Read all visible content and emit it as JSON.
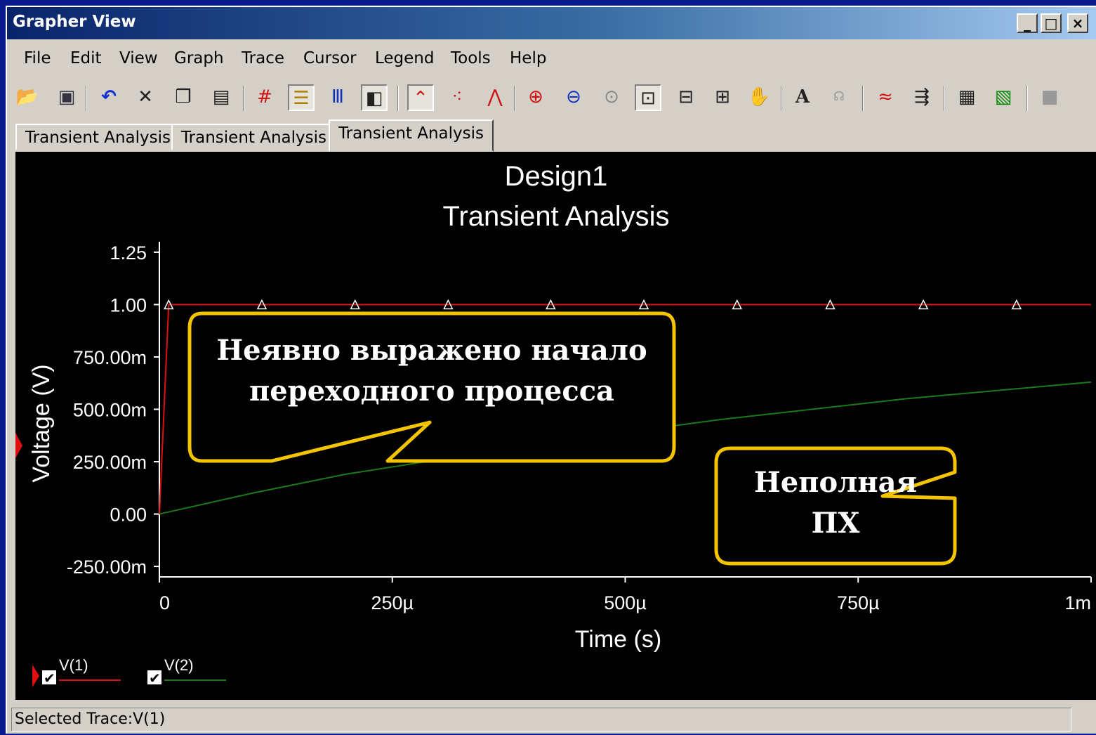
{
  "window": {
    "title": "Grapher View",
    "controls": [
      "_",
      "□",
      "×"
    ]
  },
  "menu": [
    "File",
    "Edit",
    "View",
    "Graph",
    "Trace",
    "Cursor",
    "Legend",
    "Tools",
    "Help"
  ],
  "toolbar": {
    "icons": [
      "open-icon",
      "save-icon",
      "undo-icon",
      "delete-icon",
      "copy-icon",
      "paste-icon",
      "grid-icon",
      "legend-icon",
      "dual-axis-icon",
      "overlay-icon",
      "lines-icon",
      "points-icon",
      "lines-points-icon",
      "zoom-in-icon",
      "zoom-out-icon",
      "zoom-full-icon",
      "zoom-window-icon",
      "zoom-x-icon",
      "zoom-y-icon",
      "pan-icon",
      "text-icon",
      "label-icon",
      "cursor-icon",
      "export-icon",
      "properties-icon",
      "excel-icon",
      "stop-icon"
    ]
  },
  "tabs": [
    "Transient Analysis",
    "Transient Analysis",
    "Transient Analysis"
  ],
  "active_tab": 2,
  "chart_data": {
    "type": "line",
    "title": "Design1",
    "subtitle": "Transient Analysis",
    "xlabel": "Time (s)",
    "ylabel": "Voltage (V)",
    "xlim": [
      0,
      0.001
    ],
    "ylim": [
      -0.3,
      1.3
    ],
    "x_ticks": [
      {
        "v": 0,
        "label": "0"
      },
      {
        "v": 0.00025,
        "label": "250µ"
      },
      {
        "v": 0.0005,
        "label": "500µ"
      },
      {
        "v": 0.00075,
        "label": "750µ"
      },
      {
        "v": 0.001,
        "label": "1m"
      }
    ],
    "y_ticks": [
      {
        "v": 1.25,
        "label": "1.25"
      },
      {
        "v": 1.0,
        "label": "1.00"
      },
      {
        "v": 0.75,
        "label": "750.00m"
      },
      {
        "v": 0.5,
        "label": "500.00m"
      },
      {
        "v": 0.25,
        "label": "250.00m"
      },
      {
        "v": 0.0,
        "label": "0.00"
      },
      {
        "v": -0.25,
        "label": "-250.00m"
      }
    ],
    "series": [
      {
        "name": "V(1)",
        "color": "#e01010",
        "markers": "triangle",
        "x": [
          0,
          1e-05,
          0.00011,
          0.00021,
          0.00031,
          0.00042,
          0.00052,
          0.00062,
          0.00072,
          0.00082,
          0.00092,
          0.001
        ],
        "y": [
          0,
          1.0,
          1.0,
          1.0,
          1.0,
          1.0,
          1.0,
          1.0,
          1.0,
          1.0,
          1.0,
          1.0
        ]
      },
      {
        "name": "V(2)",
        "color": "#1a7a1a",
        "x": [
          0,
          0.0001,
          0.0002,
          0.0003,
          0.0004,
          0.0005,
          0.0006,
          0.0007,
          0.0008,
          0.0009,
          0.001
        ],
        "y": [
          0,
          0.1,
          0.19,
          0.26,
          0.33,
          0.39,
          0.45,
          0.5,
          0.55,
          0.59,
          0.63
        ]
      }
    ],
    "legend": [
      {
        "name": "V(1)",
        "checked": true,
        "color": "#e01010",
        "selected": true
      },
      {
        "name": "V(2)",
        "checked": true,
        "color": "#1a7a1a",
        "selected": false
      }
    ],
    "grid": false,
    "annotations": [
      {
        "lines": [
          "Неявно выражено начало",
          "переходного процесса"
        ],
        "border": "#f5c400"
      },
      {
        "lines": [
          "Неполная",
          "ПХ"
        ],
        "border": "#f5c400"
      }
    ]
  },
  "status": "Selected Trace:V(1)"
}
